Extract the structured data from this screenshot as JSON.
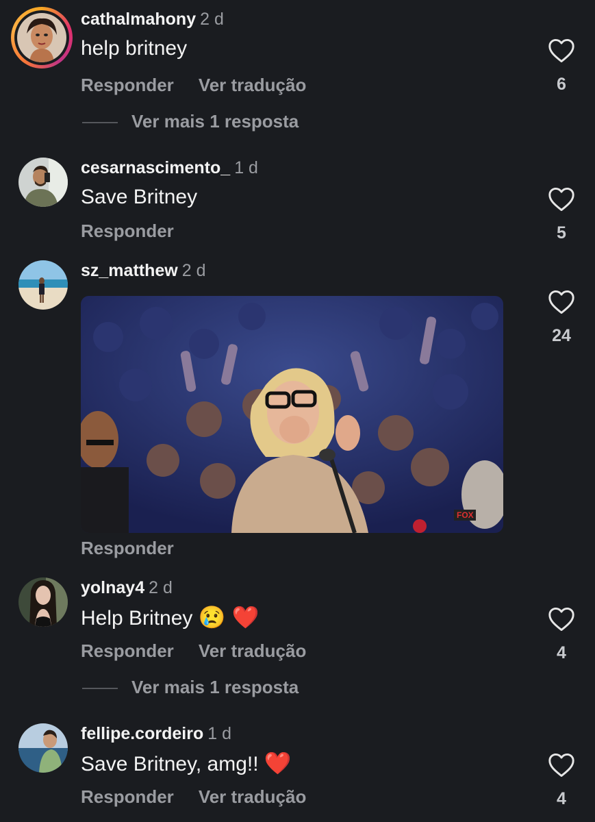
{
  "comments": [
    {
      "username": "cathalmahony",
      "time": "2 d",
      "text": "help britney",
      "reply_label": "Responder",
      "translate_label": "Ver tradução",
      "likes": "6",
      "more_replies": "Ver mais 1 resposta",
      "has_story_ring": true
    },
    {
      "username": "cesarnascimento_",
      "time": "1 d",
      "text": "Save Britney",
      "reply_label": "Responder",
      "likes": "5"
    },
    {
      "username": "sz_matthew",
      "time": "2 d",
      "media": "gif",
      "gif_badge": "FOX",
      "reply_label": "Responder",
      "likes": "24"
    },
    {
      "username": "yolnay4",
      "time": "2 d",
      "text": "Help Britney",
      "text_emojis": "😢 ❤️",
      "reply_label": "Responder",
      "translate_label": "Ver tradução",
      "likes": "4",
      "more_replies": "Ver mais 1 resposta"
    },
    {
      "username": "fellipe.cordeiro",
      "time": "1 d",
      "text": "Save Britney, amg!!",
      "text_emojis": "❤️",
      "reply_label": "Responder",
      "translate_label": "Ver tradução",
      "likes": "4"
    }
  ],
  "colors": {
    "background": "#1a1c20",
    "primary_text": "#f3f3f3",
    "secondary_text": "#9a9ca1",
    "heart_outline": "#e6e6e6"
  },
  "icons": [
    "heart-outline-icon"
  ]
}
